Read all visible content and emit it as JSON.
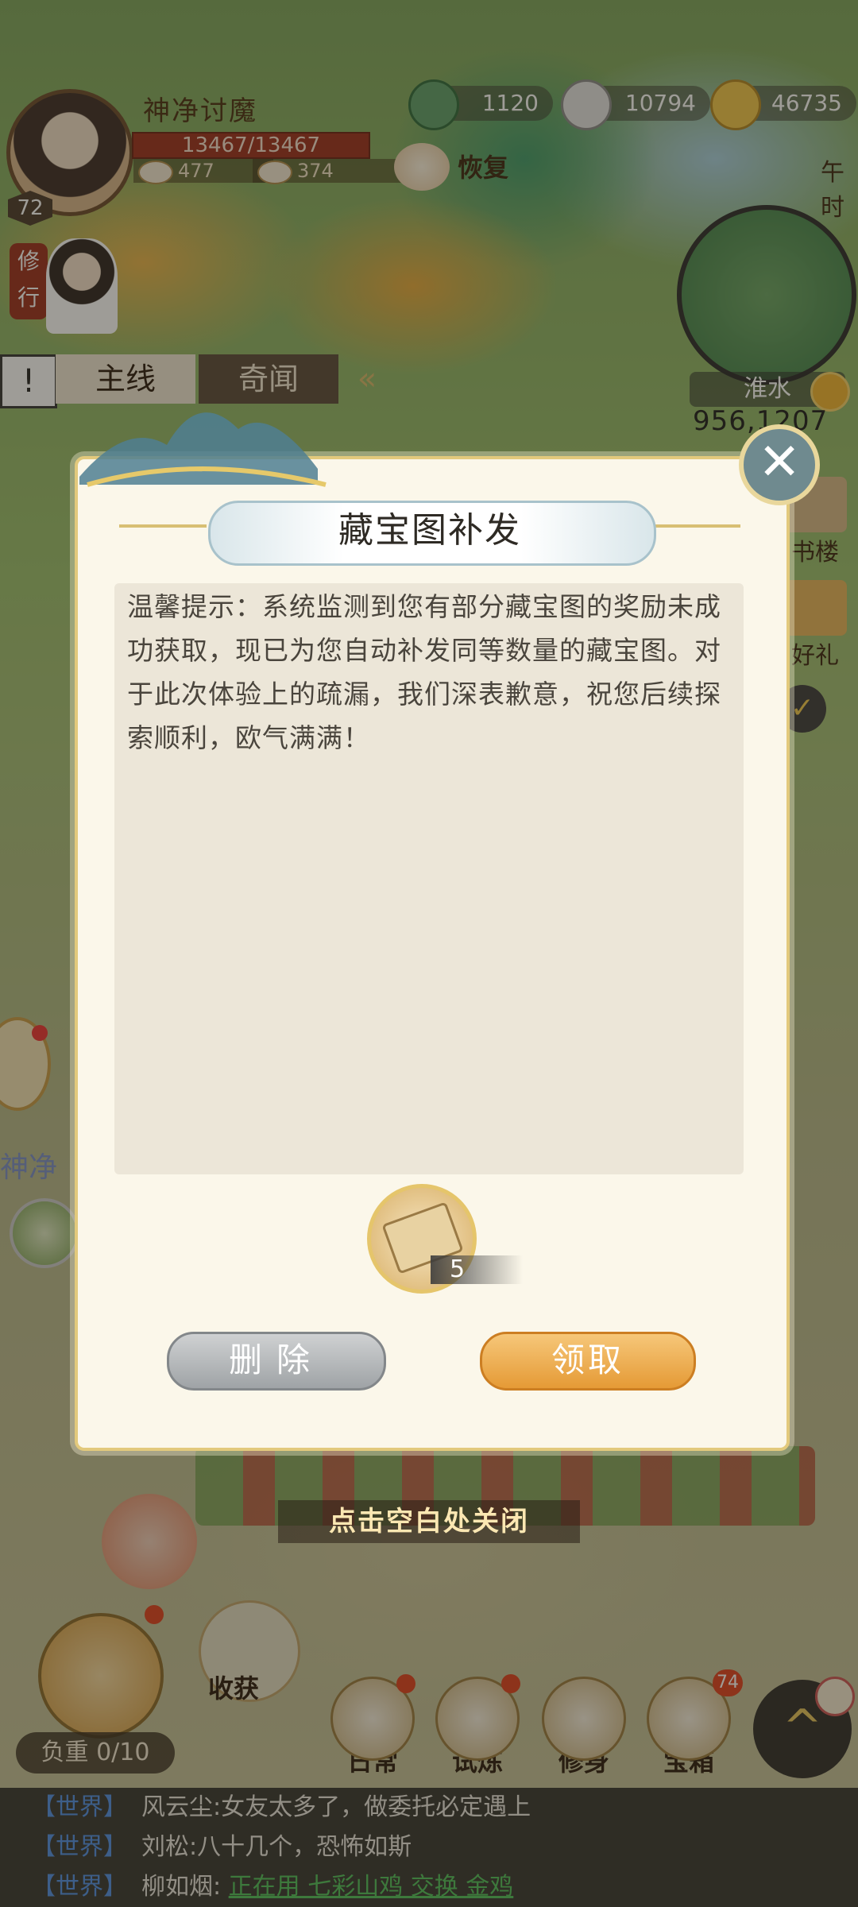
{
  "player": {
    "name": "神净讨魔",
    "hp": "13467/13467",
    "level": "72",
    "stat1": "477",
    "stat2": "374"
  },
  "resources": [
    {
      "icon": "jade-icon",
      "value": "1120"
    },
    {
      "icon": "silver-ingot-icon",
      "value": "10794"
    },
    {
      "icon": "gold-coin-icon",
      "value": "46735"
    }
  ],
  "recover_label": "恢复",
  "time_label": "午时",
  "map": {
    "name": "淮水",
    "coords": "956,1207"
  },
  "side": {
    "cultivate_label": "修行",
    "shen_label": "神净"
  },
  "quest_tabs": {
    "alert": "!",
    "main": "主线",
    "news": "奇闻",
    "collapse": "«"
  },
  "right_menu": {
    "book_label": "书楼",
    "gift_label": "好礼"
  },
  "modal": {
    "title": "藏宝图补发",
    "message": "温馨提示：系统监测到您有部分藏宝图的奖励未成功获取，现已为您自动补发同等数量的藏宝图。对于此次体验上的疏漏，我们深表歉意，祝您后续探索顺利，欧气满满！",
    "reward": {
      "icon": "treasure-map-scroll-icon",
      "count": "5"
    },
    "delete_label": "删除",
    "claim_label": "领取",
    "close_hint": "点击空白处关闭"
  },
  "bottom": {
    "harvest_label": "收获",
    "load_label": "负重 0/10",
    "buttons": [
      {
        "label": "日常",
        "icon": "daily-icon",
        "dot": true
      },
      {
        "label": "试炼",
        "icon": "trial-icon",
        "dot": true
      },
      {
        "label": "修身",
        "icon": "cultivation-icon",
        "dot": false
      },
      {
        "label": "宝箱",
        "icon": "chest-icon",
        "badge": "74"
      }
    ]
  },
  "chat": [
    {
      "channel": "【世界】",
      "name": "风云尘:",
      "message": "女友太多了，做委托必定遇上",
      "link": ""
    },
    {
      "channel": "【世界】",
      "name": "刘松:",
      "message": "八十几个，恐怖如斯",
      "link": ""
    },
    {
      "channel": "【世界】",
      "name": "柳如烟:",
      "message": "",
      "link": "正在用 七彩山鸡 交换 金鸡"
    }
  ],
  "colors": {
    "claim_button": "#e59a36",
    "delete_button": "#9fa3a6",
    "hp_bar": "#9c2e1c",
    "chat_channel": "#4f8fe6",
    "chat_link": "#4fbf5a"
  }
}
